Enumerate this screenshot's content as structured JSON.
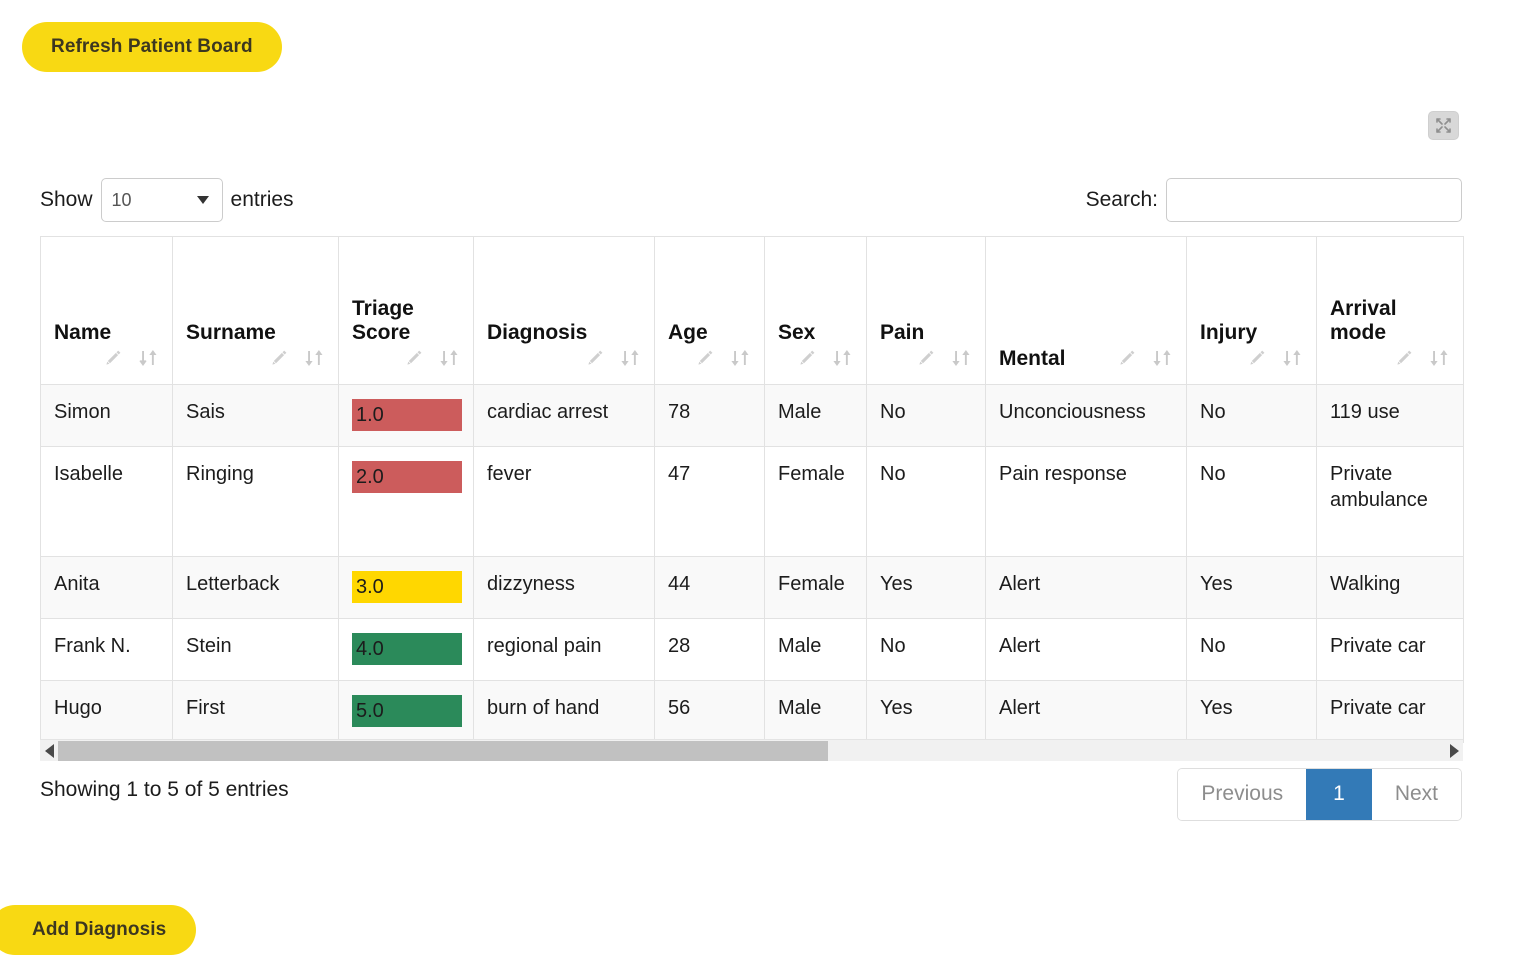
{
  "toolbar": {
    "refresh_label": "Refresh Patient Board",
    "add_diagnosis_label": "Add Diagnosis"
  },
  "fullscreen": {
    "icon": "expand-arrows-icon"
  },
  "controls": {
    "show_label": "Show",
    "entries_label": "entries",
    "page_length": "10",
    "search_label": "Search:",
    "search_value": "",
    "search_placeholder": ""
  },
  "table": {
    "columns": [
      {
        "label": "Triage\nScore",
        "key": "triage"
      }
    ],
    "headers": [
      {
        "label": "Name",
        "layout": "stacked"
      },
      {
        "label": "Surname",
        "layout": "stacked"
      },
      {
        "label": "Triage Score",
        "line1": "Triage",
        "line2": "Score",
        "layout": "stacked"
      },
      {
        "label": "Diagnosis",
        "layout": "stacked"
      },
      {
        "label": "Age",
        "layout": "stacked"
      },
      {
        "label": "Sex",
        "layout": "stacked"
      },
      {
        "label": "Pain",
        "layout": "stacked"
      },
      {
        "label": "Mental",
        "layout": "inline"
      },
      {
        "label": "Injury",
        "layout": "stacked"
      },
      {
        "label": "Arrival mode",
        "line1": "Arrival",
        "line2": "mode",
        "layout": "stacked"
      }
    ],
    "rows": [
      {
        "name": "Simon",
        "surname": "Sais",
        "triage": "1.0",
        "triage_color": "red",
        "diagnosis": "cardiac arrest",
        "age": "78",
        "sex": "Male",
        "pain": "No",
        "mental": "Unconciousness",
        "injury": "No",
        "arrival": "119 use"
      },
      {
        "name": "Isabelle",
        "surname": "Ringing",
        "triage": "2.0",
        "triage_color": "red",
        "diagnosis": "fever",
        "age": "47",
        "sex": "Female",
        "pain": "No",
        "mental": "Pain response",
        "injury": "No",
        "arrival": "Private ambulance"
      },
      {
        "name": "Anita",
        "surname": "Letterback",
        "triage": "3.0",
        "triage_color": "yellow",
        "diagnosis": "dizzyness",
        "age": "44",
        "sex": "Female",
        "pain": "Yes",
        "mental": "Alert",
        "injury": "Yes",
        "arrival": "Walking"
      },
      {
        "name": "Frank N.",
        "surname": "Stein",
        "triage": "4.0",
        "triage_color": "green",
        "diagnosis": "regional pain",
        "age": "28",
        "sex": "Male",
        "pain": "No",
        "mental": "Alert",
        "injury": "No",
        "arrival": "Private car"
      },
      {
        "name": "Hugo",
        "surname": "First",
        "triage": "5.0",
        "triage_color": "green",
        "diagnosis": "burn of hand",
        "age": "56",
        "sex": "Male",
        "pain": "Yes",
        "mental": "Alert",
        "injury": "Yes",
        "arrival": "Private car"
      }
    ]
  },
  "footer": {
    "info": "Showing 1 to 5 of 5 entries",
    "previous_label": "Previous",
    "page_1_label": "1",
    "next_label": "Next"
  },
  "colors": {
    "brand_yellow": "#f8d913",
    "triage_red": "#cc5c5c",
    "triage_yellow": "#ffd700",
    "triage_green": "#2b8a5a",
    "pagination_active": "#337ab7"
  }
}
